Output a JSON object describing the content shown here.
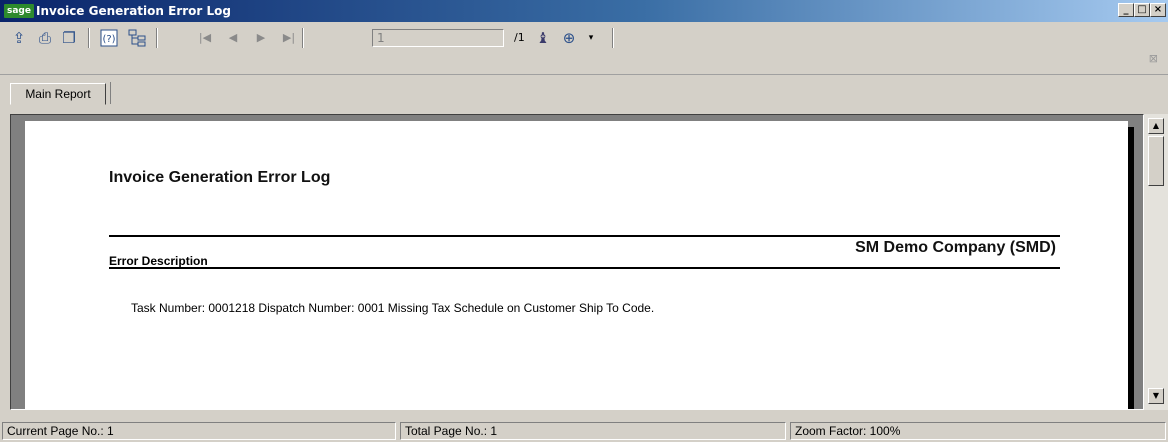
{
  "window": {
    "title": "Invoice Generation Error Log",
    "logo_text": "sage"
  },
  "toolbar": {
    "page_value": "1",
    "page_total": "/1"
  },
  "tabs": {
    "main": "Main Report"
  },
  "report": {
    "title": "Invoice Generation Error Log",
    "company": "SM Demo Company (SMD)",
    "column_header": "Error Description",
    "line": "Task Number: 0001218  Dispatch Number: 0001 Missing Tax Schedule on Customer Ship To Code."
  },
  "status": {
    "current": "Current Page No.: 1",
    "total": "Total Page No.: 1",
    "zoom": "Zoom Factor: 100%"
  }
}
